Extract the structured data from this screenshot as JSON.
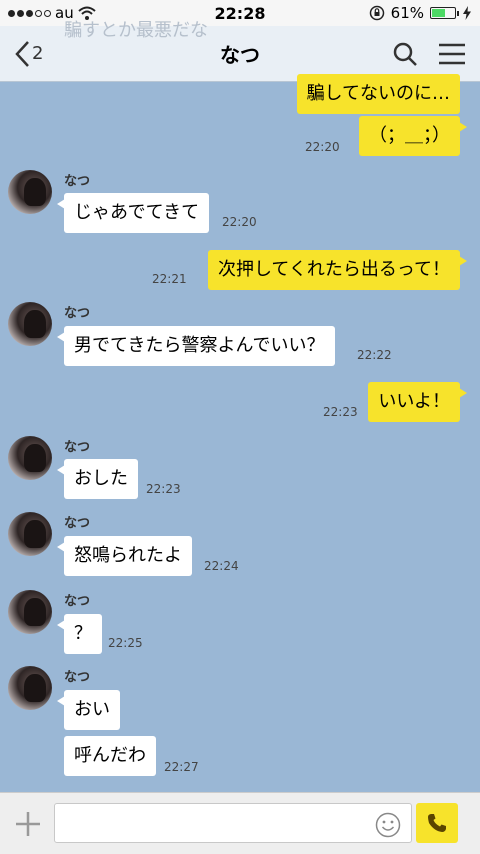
{
  "status": {
    "carrier": "au",
    "time": "22:28",
    "battery": "61%",
    "battery_level": 0.61,
    "signal_bars": 3
  },
  "header": {
    "ghost_text": "騙すとか最悪だな",
    "back_count": "2",
    "title": "なつ"
  },
  "messages": [
    {
      "side": "out",
      "text": "騙してないのに…",
      "time": ""
    },
    {
      "side": "out",
      "text": "（；＿；）",
      "time": "22:20"
    },
    {
      "side": "in",
      "name": "なつ",
      "text": "じゃあでてきて",
      "time": "22:20"
    },
    {
      "side": "out",
      "text": "次押してくれたら出るって！",
      "time": "22:21"
    },
    {
      "side": "in",
      "name": "なつ",
      "text": "男でてきたら警察よんでいい？",
      "time": "22:22"
    },
    {
      "side": "out",
      "text": "いいよ！",
      "time": "22:23"
    },
    {
      "side": "in",
      "name": "なつ",
      "text": "おした",
      "time": "22:23"
    },
    {
      "side": "in",
      "name": "なつ",
      "text": "怒鳴られたよ",
      "time": "22:24"
    },
    {
      "side": "in",
      "name": "なつ",
      "text": "？",
      "time": "22:25"
    },
    {
      "side": "in",
      "name": "なつ",
      "text": "おい",
      "time": ""
    },
    {
      "side": "in",
      "name": "",
      "text": "呼んだわ",
      "time": "22:27"
    }
  ],
  "input": {
    "placeholder": ""
  },
  "colors": {
    "background": "#9ab7d5",
    "outgoing_bubble": "#f7e32b",
    "incoming_bubble": "#ffffff"
  }
}
